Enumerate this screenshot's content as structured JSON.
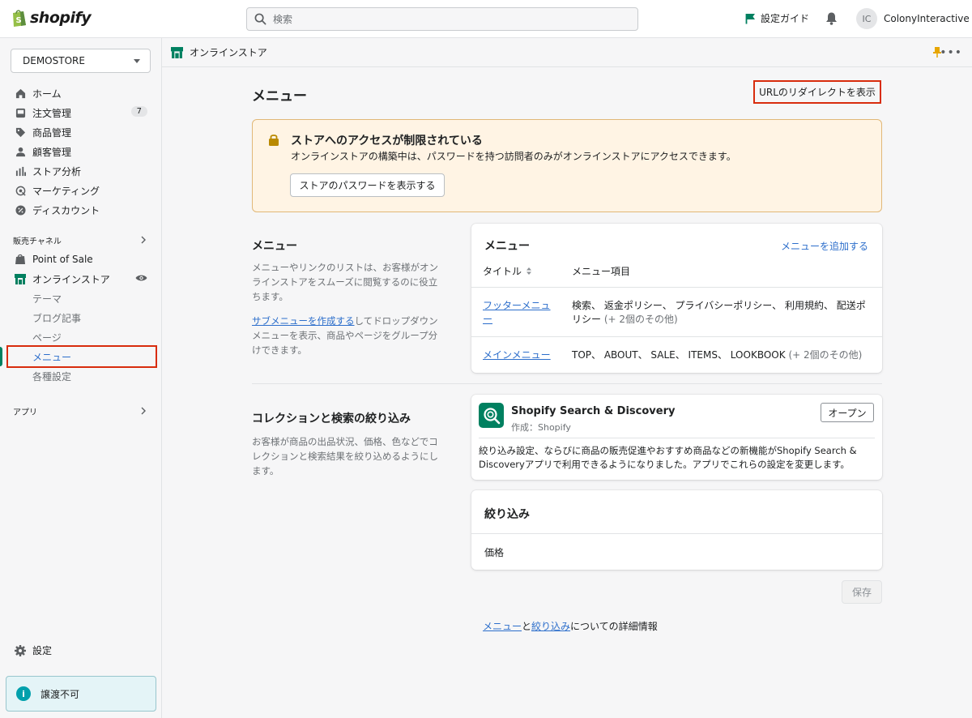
{
  "topbar": {
    "logo_text": "shopify",
    "search_placeholder": "検索",
    "guide_label": "設定ガイド",
    "user_initials": "IC",
    "user_name": "ColonyInteractive"
  },
  "sidebar": {
    "store_name": "DEMOSTORE",
    "items": [
      {
        "label": "ホーム",
        "icon": "home-icon"
      },
      {
        "label": "注文管理",
        "icon": "orders-icon",
        "badge": "7"
      },
      {
        "label": "商品管理",
        "icon": "tag-icon"
      },
      {
        "label": "顧客管理",
        "icon": "person-icon"
      },
      {
        "label": "ストア分析",
        "icon": "analytics-icon"
      },
      {
        "label": "マーケティング",
        "icon": "marketing-icon"
      },
      {
        "label": "ディスカウント",
        "icon": "discount-icon"
      }
    ],
    "sales_channels_label": "販売チャネル",
    "pos_label": "Point of Sale",
    "online_store_label": "オンラインストア",
    "online_store_sub": [
      "テーマ",
      "ブログ記事",
      "ページ",
      "メニュー",
      "各種設定"
    ],
    "apps_label": "アプリ",
    "settings_label": "設定",
    "notice_text": "譲渡不可"
  },
  "breadcrumb": {
    "label": "オンラインストア"
  },
  "page": {
    "title": "メニュー",
    "redirect_button": "URLのリダイレクトを表示"
  },
  "banner": {
    "title": "ストアへのアクセスが制限されている",
    "text": "オンラインストアの構築中は、パスワードを持つ訪問者のみがオンラインストアにアクセスできます。",
    "button": "ストアのパスワードを表示する"
  },
  "menu_section": {
    "title": "メニュー",
    "desc1": "メニューやリンクのリストは、お客様がオンラインストアをスムーズに閲覧するのに役立ちます。",
    "desc2_link": "サブメニューを作成する",
    "desc2_rest": "してドロップダウンメニューを表示、商品やページをグループ分けできます。",
    "card_title": "メニュー",
    "add_link": "メニューを追加する",
    "col_title": "タイトル",
    "col_items": "メニュー項目",
    "rows": [
      {
        "title": "フッターメニュー",
        "items": "検索、 返金ポリシー、 プライバシーポリシー、 利用規約、 配送ポリシー",
        "more": "(+ 2個のその他)"
      },
      {
        "title": "メインメニュー",
        "items": "TOP、 ABOUT、 SALE、 ITEMS、 LOOKBOOK",
        "more": "(+ 2個のその他)"
      }
    ]
  },
  "collection_section": {
    "title": "コレクションと検索の絞り込み",
    "desc": "お客様が商品の出品状況、価格、色などでコレクションと検索結果を絞り込めるようにします。",
    "app_name": "Shopify Search & Discovery",
    "app_author": "作成：Shopify",
    "open_button": "オープン",
    "app_desc": "絞り込み設定、ならびに商品の販売促進やおすすめ商品などの新機能がShopify Search & Discoveryアプリで利用できるようになりました。アプリでこれらの設定を変更します。",
    "filter_title": "絞り込み",
    "filter_item": "価格"
  },
  "footer": {
    "save_button": "保存",
    "link_menu": "メニュー",
    "and": "と",
    "link_filter": "絞り込み",
    "rest": "についての詳細情報"
  }
}
